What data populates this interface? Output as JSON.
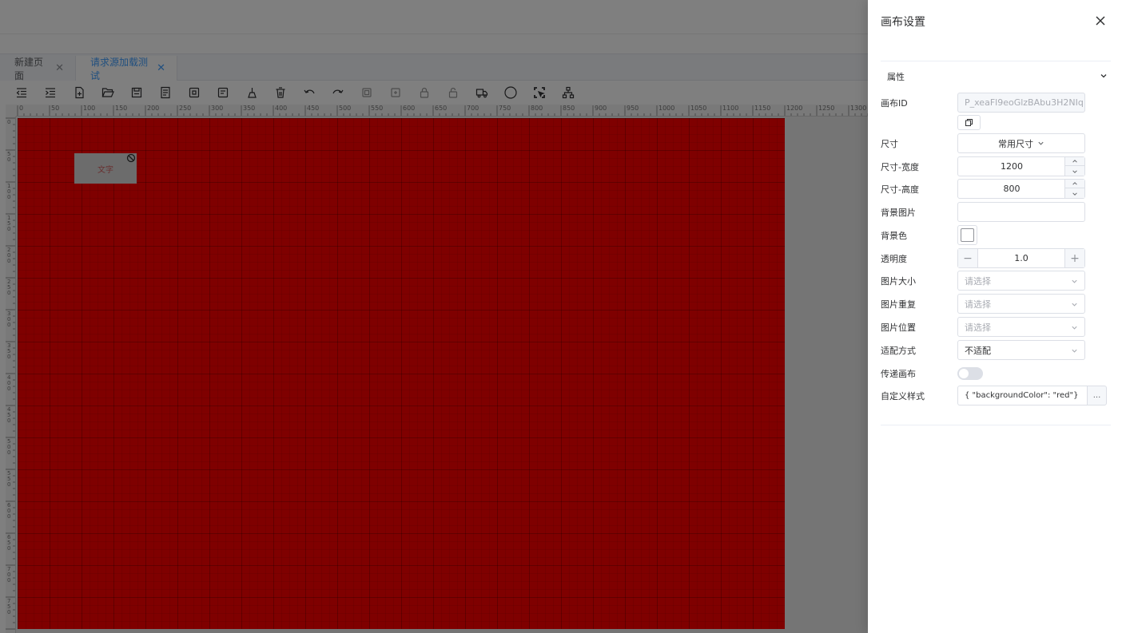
{
  "tabs": [
    {
      "label": "新建页面",
      "active": false
    },
    {
      "label": "请求源加载测试",
      "active": true
    }
  ],
  "toolbar_icons": [
    "indent-left-icon",
    "indent-right-icon",
    "new-file-icon",
    "open-folder-icon",
    "save-icon",
    "save-as-icon",
    "import-icon",
    "export-icon",
    "clear-icon",
    "delete-icon",
    "undo-icon",
    "redo-icon",
    "copy-icon",
    "paste-icon",
    "lock-icon",
    "unlock-icon",
    "truck-icon",
    "circle-icon",
    "select-area-icon",
    "tree-icon"
  ],
  "ruler": {
    "top_labels": [
      "0",
      "50",
      "100",
      "150",
      "200",
      "250",
      "300",
      "350",
      "400",
      "450",
      "500",
      "550",
      "600",
      "650",
      "700",
      "750",
      "800",
      "850",
      "900",
      "950",
      "1000",
      "1050",
      "1100",
      "1150",
      "1200",
      "1250",
      "1300"
    ],
    "left_labels": [
      "0",
      "50",
      "100",
      "150",
      "200",
      "250",
      "300",
      "350",
      "400",
      "450",
      "500",
      "550",
      "600",
      "650",
      "700",
      "750"
    ]
  },
  "canvas": {
    "background_color": "#ff0000",
    "component_text": "文字"
  },
  "drawer": {
    "title": "画布设置",
    "section_title": "属性",
    "fields": {
      "canvas_id_label": "画布ID",
      "canvas_id_value": "P_xeaFl9eoGlzBAbu3H2NIq",
      "size_label": "尺寸",
      "size_value": "常用尺寸",
      "width_label": "尺寸-宽度",
      "width_value": "1200",
      "height_label": "尺寸-高度",
      "height_value": "800",
      "bg_image_label": "背景图片",
      "bg_image_value": "",
      "bg_color_label": "背景色",
      "opacity_label": "透明度",
      "opacity_value": "1.0",
      "image_size_label": "图片大小",
      "image_size_placeholder": "请选择",
      "image_repeat_label": "图片重复",
      "image_repeat_placeholder": "请选择",
      "image_position_label": "图片位置",
      "image_position_placeholder": "请选择",
      "fit_mode_label": "适配方式",
      "fit_mode_value": "不适配",
      "pass_canvas_label": "传递画布",
      "pass_canvas_on": false,
      "custom_style_label": "自定义样式",
      "custom_style_value": "{  \"backgroundColor\": \"red\"}",
      "more_label": "..."
    }
  }
}
